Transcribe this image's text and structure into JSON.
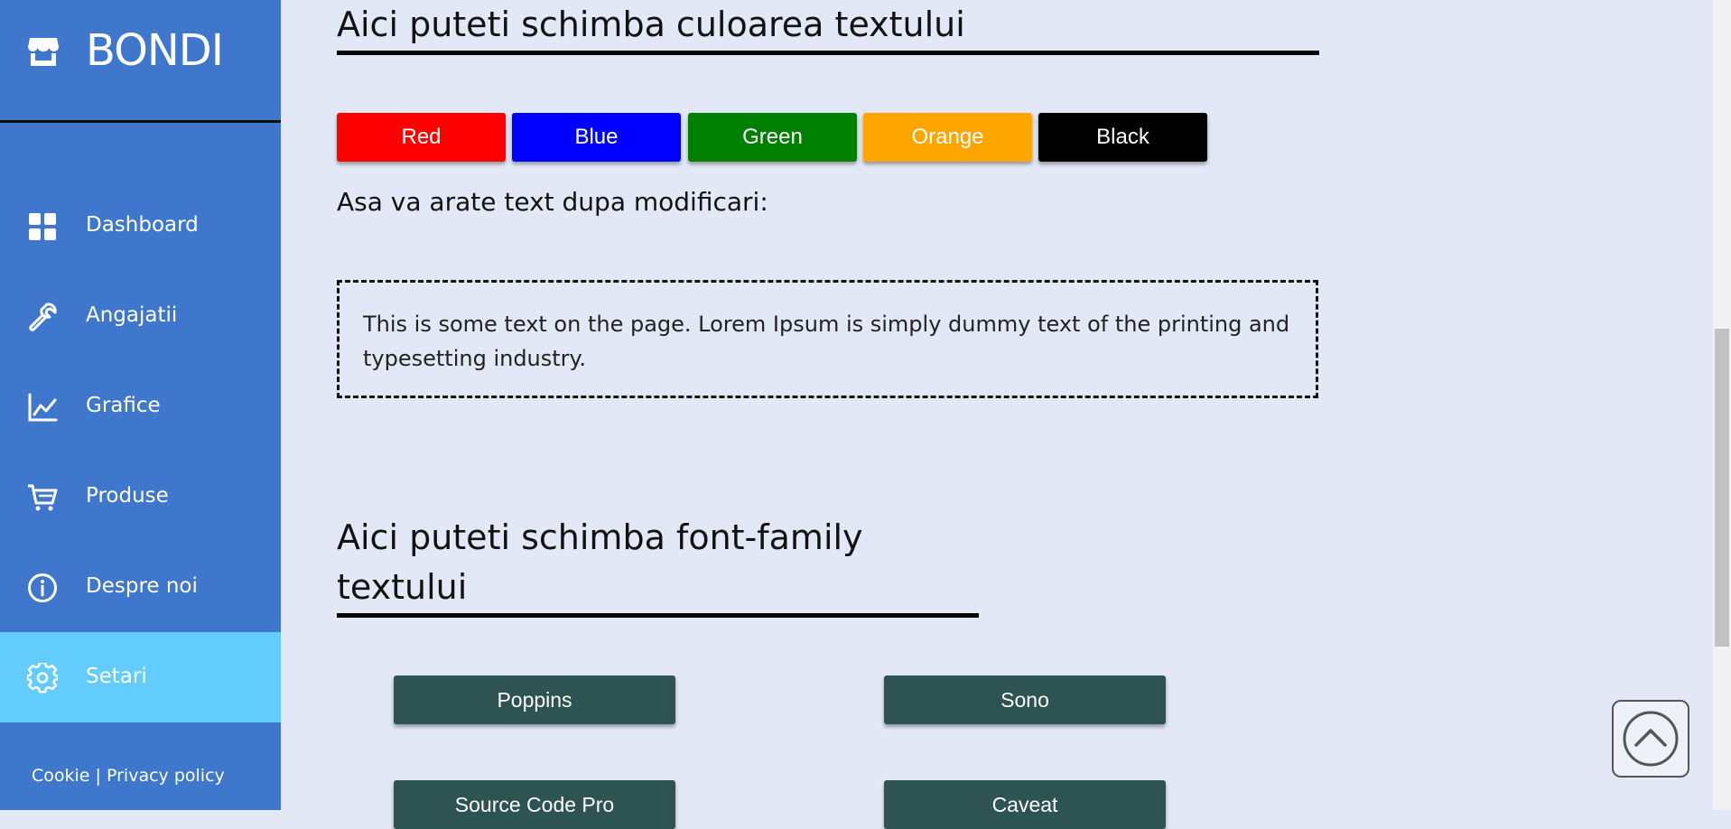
{
  "sidebar": {
    "brand": "BONDI",
    "items": [
      {
        "label": "Dashboard",
        "icon": "grid-icon"
      },
      {
        "label": "Angajatii",
        "icon": "wrench-icon"
      },
      {
        "label": "Grafice",
        "icon": "chart-line-icon"
      },
      {
        "label": "Produse",
        "icon": "cart-icon"
      },
      {
        "label": "Despre noi",
        "icon": "info-icon"
      },
      {
        "label": "Setari",
        "icon": "gear-icon",
        "active": true
      }
    ],
    "footer": {
      "cookie": "Cookie",
      "separator": "|",
      "privacy": "Privacy policy"
    }
  },
  "color_section": {
    "title": "Aici puteti schimba culoarea textului",
    "buttons": [
      {
        "label": "Red",
        "color": "#ff0000"
      },
      {
        "label": "Blue",
        "color": "#0000ff"
      },
      {
        "label": "Green",
        "color": "#008000"
      },
      {
        "label": "Orange",
        "color": "#ffa500"
      },
      {
        "label": "Black",
        "color": "#000000"
      }
    ],
    "preview_label": "Asa va arate text dupa modificari:",
    "preview_text": "This is some text on the page. Lorem Ipsum is simply dummy text of the printing and typesetting industry."
  },
  "font_section": {
    "title_line1": "Aici puteti schimba font-family",
    "title_line2": "textului",
    "buttons": [
      {
        "label": "Poppins"
      },
      {
        "label": "Sono"
      },
      {
        "label": "Source Code Pro"
      },
      {
        "label": "Caveat"
      }
    ]
  },
  "colors": {
    "sidebar_bg": "#3f77cc",
    "active_item_bg": "#62ccfc",
    "page_bg": "#e2e8f6",
    "font_button_bg": "#2d5352"
  }
}
